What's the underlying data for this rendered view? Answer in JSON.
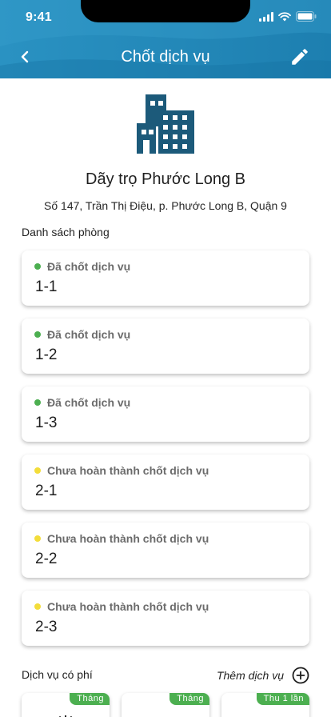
{
  "status_bar": {
    "time": "9:41"
  },
  "header": {
    "title": "Chốt dịch vụ"
  },
  "building": {
    "name": "Dãy trọ Phước Long B",
    "address": "Số 147, Trần Thị Điệu, p. Phước Long B, Quận 9"
  },
  "rooms_section": {
    "label": "Danh sách phòng",
    "rooms": [
      {
        "status": "Đã chốt dịch vụ",
        "status_color": "#4caf50",
        "name": "1-1"
      },
      {
        "status": "Đã chốt dịch vụ",
        "status_color": "#4caf50",
        "name": "1-2"
      },
      {
        "status": "Đã chốt dịch vụ",
        "status_color": "#4caf50",
        "name": "1-3"
      },
      {
        "status": "Chưa hoàn thành chốt dịch vụ",
        "status_color": "#f3dd3a",
        "name": "2-1"
      },
      {
        "status": "Chưa hoàn thành chốt dịch vụ",
        "status_color": "#f3dd3a",
        "name": "2-2"
      },
      {
        "status": "Chưa hoàn thành chốt dịch vụ",
        "status_color": "#f3dd3a",
        "name": "2-3"
      }
    ]
  },
  "services": {
    "label": "Dịch vụ có phí",
    "add_label": "Thêm dịch vụ",
    "cards": [
      {
        "badge": "Tháng",
        "icon": "electricity-icon"
      },
      {
        "badge": "Tháng",
        "icon": "water-drop-icon"
      },
      {
        "badge": "Thu 1 lần",
        "icon": "device-icon"
      }
    ]
  },
  "colors": {
    "header_blue": "#1f87b8",
    "icon_navy": "#1c5a7a",
    "done": "#4caf50",
    "pending": "#f3dd3a",
    "badge": "#4caf50"
  }
}
